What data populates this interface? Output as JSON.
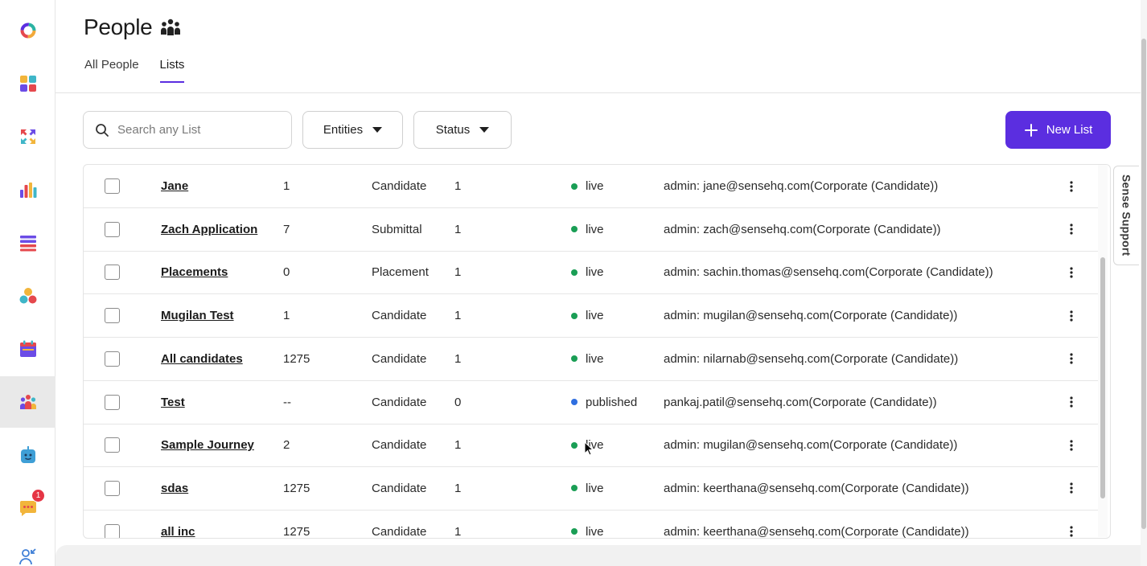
{
  "page": {
    "title": "People",
    "tabs": [
      {
        "label": "All People",
        "active": false
      },
      {
        "label": "Lists",
        "active": true
      }
    ]
  },
  "toolbar": {
    "search_placeholder": "Search any List",
    "entities_label": "Entities",
    "status_label": "Status",
    "new_list_label": "New List"
  },
  "support": {
    "label": "Sense Support"
  },
  "notifications": {
    "messages_count": "1"
  },
  "colors": {
    "accent": "#5b2ee0",
    "live": "#1a9e55",
    "published": "#2f6fe0",
    "badge": "#e53545"
  },
  "sidebar": {
    "items": [
      {
        "icon": "logo-icon"
      },
      {
        "icon": "dashboard-icon"
      },
      {
        "icon": "integrations-icon"
      },
      {
        "icon": "analytics-icon"
      },
      {
        "icon": "lists-icon"
      },
      {
        "icon": "segments-icon"
      },
      {
        "icon": "calendar-icon"
      },
      {
        "icon": "people-icon",
        "active": true
      },
      {
        "icon": "bot-icon"
      },
      {
        "icon": "messages-icon"
      },
      {
        "icon": "user-import-icon"
      }
    ]
  },
  "lists": {
    "rows": [
      {
        "name": "Jane",
        "count": "1",
        "entity": "Candidate",
        "num": "1",
        "status": "live",
        "owner": "admin: jane@sensehq.com(Corporate (Candidate))"
      },
      {
        "name": "Zach Application",
        "count": "7",
        "entity": "Submittal",
        "num": "1",
        "status": "live",
        "owner": "admin: zach@sensehq.com(Corporate (Candidate))"
      },
      {
        "name": "Placements",
        "count": "0",
        "entity": "Placement",
        "num": "1",
        "status": "live",
        "owner": "admin: sachin.thomas@sensehq.com(Corporate (Candidate))"
      },
      {
        "name": "Mugilan Test",
        "count": "1",
        "entity": "Candidate",
        "num": "1",
        "status": "live",
        "owner": "admin: mugilan@sensehq.com(Corporate (Candidate))"
      },
      {
        "name": "All candidates",
        "count": "1275",
        "entity": "Candidate",
        "num": "1",
        "status": "live",
        "owner": "admin: nilarnab@sensehq.com(Corporate (Candidate))"
      },
      {
        "name": "Test",
        "count": "--",
        "entity": "Candidate",
        "num": "0",
        "status": "published",
        "owner": "pankaj.patil@sensehq.com(Corporate (Candidate))"
      },
      {
        "name": "Sample Journey",
        "count": "2",
        "entity": "Candidate",
        "num": "1",
        "status": "live",
        "owner": "admin: mugilan@sensehq.com(Corporate (Candidate))"
      },
      {
        "name": "sdas",
        "count": "1275",
        "entity": "Candidate",
        "num": "1",
        "status": "live",
        "owner": "admin: keerthana@sensehq.com(Corporate (Candidate))"
      },
      {
        "name": "all inc",
        "count": "1275",
        "entity": "Candidate",
        "num": "1",
        "status": "live",
        "owner": "admin: keerthana@sensehq.com(Corporate (Candidate))"
      }
    ]
  }
}
